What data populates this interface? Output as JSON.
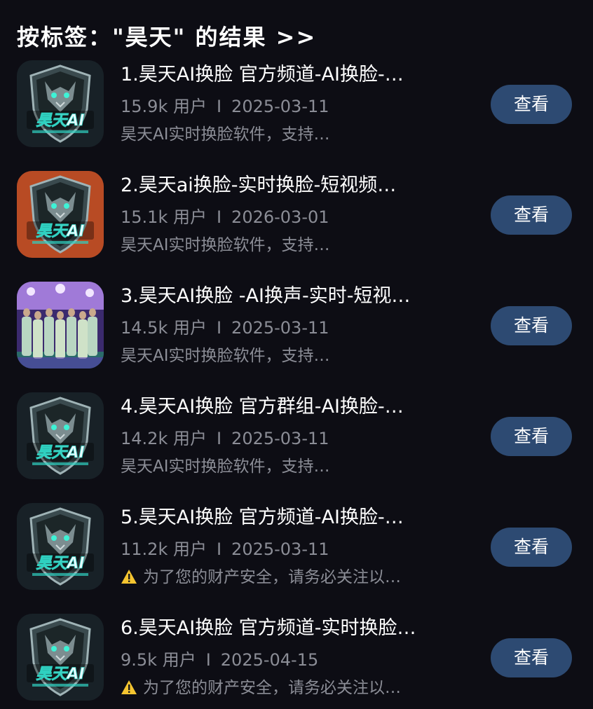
{
  "heading": "按标签：\"昊天\" 的结果 >>",
  "logo_text": "昊天AI",
  "items": [
    {
      "title": "1.昊天AI换脸 官方频道-AI换脸-…",
      "users": "15.9k 用户",
      "separator": "I",
      "date": "2025-03-11",
      "desc": "昊天AI实时换脸软件，支持…",
      "warning": false,
      "button": "查看",
      "thumb": "dark-logo"
    },
    {
      "title": "2.昊天ai换脸-实时换脸-短视频…",
      "users": "15.1k 用户",
      "separator": "I",
      "date": "2026-03-01",
      "desc": "昊天AI实时换脸软件，支持…",
      "warning": false,
      "button": "查看",
      "thumb": "fire-logo"
    },
    {
      "title": "3.昊天AI换脸 -AI换声-实时-短视…",
      "users": "14.5k 用户",
      "separator": "I",
      "date": "2025-03-11",
      "desc": "昊天AI实时换脸软件，支持…",
      "warning": false,
      "button": "查看",
      "thumb": "stage-photo"
    },
    {
      "title": "4.昊天AI换脸 官方群组-AI换脸-…",
      "users": "14.2k 用户",
      "separator": "I",
      "date": "2025-03-11",
      "desc": "昊天AI实时换脸软件，支持…",
      "warning": false,
      "button": "查看",
      "thumb": "dark-logo"
    },
    {
      "title": "5.昊天AI换脸 官方频道-AI换脸-…",
      "users": "11.2k 用户",
      "separator": "I",
      "date": "2025-03-11",
      "desc": "为了您的财产安全，请务必关注以…",
      "warning": true,
      "button": "查看",
      "thumb": "dark-logo"
    },
    {
      "title": "6.昊天AI换脸 官方频道-实时换脸…",
      "users": "9.5k 用户",
      "separator": "I",
      "date": "2025-04-15",
      "desc": "为了您的财产安全，请务必关注以…",
      "warning": true,
      "button": "查看",
      "thumb": "dark-logo"
    }
  ],
  "colors": {
    "background": "#0d0d14",
    "button": "#2d4a72",
    "secondary_text": "#8b8d96",
    "warning": "#f4c430"
  }
}
